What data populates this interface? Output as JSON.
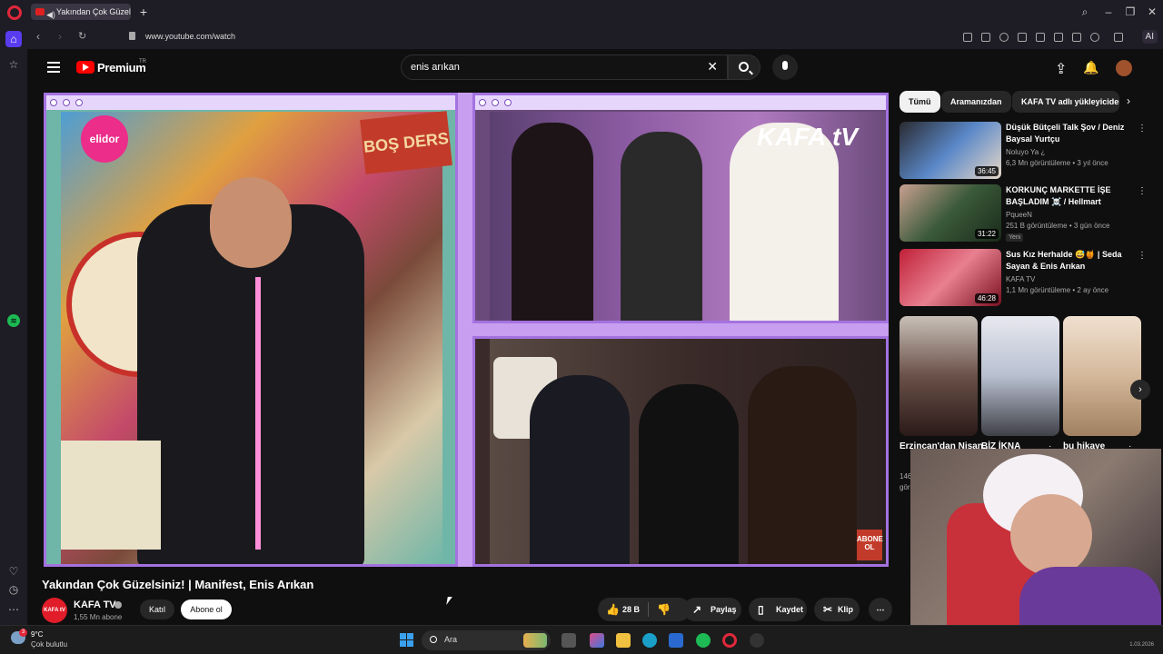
{
  "browser": {
    "tab_title": "Yakından Çok Güzelsin",
    "url": "www.youtube.com/watch",
    "ai_label": "AI"
  },
  "youtube": {
    "brand": "Premium",
    "brand_suffix": "TR",
    "search_value": "enis arıkan"
  },
  "video": {
    "elidor_sticker": "elidor",
    "bosders_sticker": "BOŞ DERS",
    "kafatv_logo": "KAFA tV",
    "abone_sticker": "ABONE OL",
    "title": "Yakından Çok Güzelsiniz! | Manifest, Enis Arıkan",
    "channel": "KAFA TV",
    "channel_avatar": "KAFA tV",
    "subscribers": "1,55 Mn abone",
    "join_label": "Katıl",
    "subscribe_label": "Abone ol",
    "likes": "28 B",
    "share_label": "Paylaş",
    "save_label": "Kaydet",
    "clip_label": "Klip"
  },
  "chips": [
    "Tümü",
    "Aramanızdan",
    "KAFA TV adlı yükleyiciden"
  ],
  "recommendations": [
    {
      "title": "Düşük Bütçeli Talk Şov / Deniz Baysal Yurtçu",
      "channel": "Noluyo Ya ¿",
      "meta": "6,3 Mn görüntüleme • 3 yıl önce",
      "duration": "36:45",
      "thumb_color": "#5a88c8"
    },
    {
      "title": "KORKUNÇ MARKETTE İŞE BAŞLADIM ☠️ / Hellmart",
      "channel": "PqueeN",
      "meta": "251 B görüntüleme • 3 gün önce",
      "duration": "31:22",
      "badge": "Yeni",
      "thumb_color": "#3a5a3a"
    },
    {
      "title": "Sus Kız Herhalde 😅🍯 | Seda Sayan & Enis Arıkan",
      "channel": "KAFA TV",
      "meta": "1,1 Mn görüntüleme • 2 ay önce",
      "duration": "46:28",
      "thumb_color": "#c02038"
    }
  ],
  "shorts": [
    {
      "title": "Erzincan'dan Nişan...",
      "color": "#6a5048"
    },
    {
      "title": "BİZ İKNA",
      "color": "#b8c0d0"
    },
    {
      "title": "bu hikaye",
      "color": "#d4b89a"
    }
  ],
  "shorts_partial": {
    "views": "146",
    "views2": "görü"
  },
  "taskbar": {
    "temperature": "9°C",
    "condition": "Çok bulutlu",
    "notifications": "3",
    "search_placeholder": "Ara",
    "date": "1.03.2026"
  }
}
